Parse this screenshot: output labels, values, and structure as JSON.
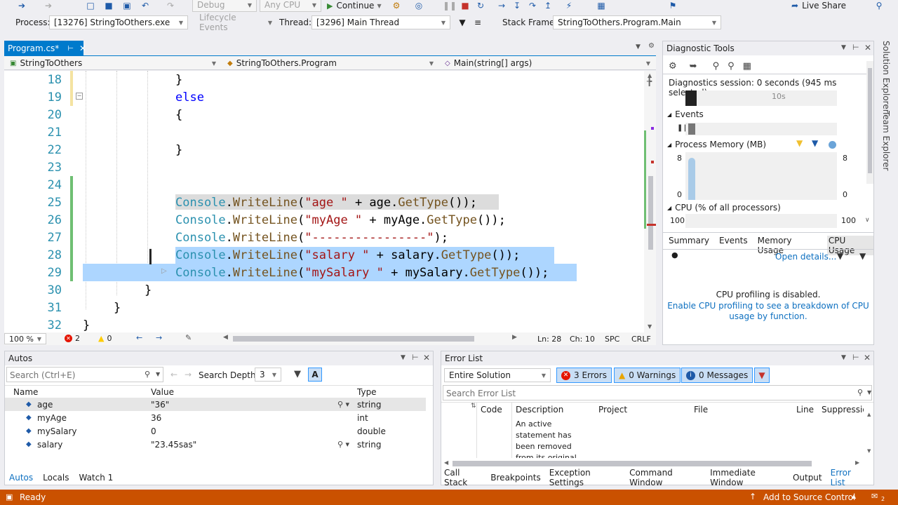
{
  "toolbar": {
    "config": "Debug",
    "platform": "Any CPU",
    "continue_label": "Continue",
    "live_share": "Live Share",
    "process_label": "Process:",
    "process_value": "[13276] StringToOthers.exe",
    "lifecycle_label": "Lifecycle Events",
    "thread_label": "Thread:",
    "thread_value": "[3296] Main Thread",
    "stackframe_label": "Stack Frame:",
    "stackframe_value": "StringToOthers.Program.Main"
  },
  "editor": {
    "tab_label": "Program.cs*",
    "nav_project": "StringToOthers",
    "nav_class": "StringToOthers.Program",
    "nav_member": "Main(string[] args)",
    "lines": [
      {
        "n": "18",
        "tokens": [
          {
            "t": "}",
            "c": ""
          }
        ]
      },
      {
        "n": "19",
        "tokens": [
          {
            "t": "else",
            "c": "kw"
          }
        ]
      },
      {
        "n": "20",
        "tokens": [
          {
            "t": "{",
            "c": ""
          }
        ]
      },
      {
        "n": "21",
        "tokens": []
      },
      {
        "n": "22",
        "tokens": [
          {
            "t": "}",
            "c": ""
          }
        ]
      },
      {
        "n": "23",
        "tokens": []
      },
      {
        "n": "24",
        "tokens": []
      },
      {
        "n": "25",
        "tokens": [
          {
            "t": "Console",
            "c": "cls"
          },
          {
            "t": ".",
            "c": ""
          },
          {
            "t": "WriteLine",
            "c": "mth"
          },
          {
            "t": "(",
            "c": ""
          },
          {
            "t": "\"age \"",
            "c": "str"
          },
          {
            "t": " + age.",
            "c": ""
          },
          {
            "t": "GetType",
            "c": "mth"
          },
          {
            "t": "());",
            "c": ""
          }
        ]
      },
      {
        "n": "26",
        "tokens": [
          {
            "t": "Console",
            "c": "cls"
          },
          {
            "t": ".",
            "c": ""
          },
          {
            "t": "WriteLine",
            "c": "mth"
          },
          {
            "t": "(",
            "c": ""
          },
          {
            "t": "\"myAge \"",
            "c": "str"
          },
          {
            "t": " + myAge.",
            "c": ""
          },
          {
            "t": "GetType",
            "c": "mth"
          },
          {
            "t": "());",
            "c": ""
          }
        ]
      },
      {
        "n": "27",
        "tokens": [
          {
            "t": "Console",
            "c": "cls"
          },
          {
            "t": ".",
            "c": ""
          },
          {
            "t": "WriteLine",
            "c": "mth"
          },
          {
            "t": "(",
            "c": ""
          },
          {
            "t": "\"----------------\"",
            "c": "str"
          },
          {
            "t": ");",
            "c": ""
          }
        ]
      },
      {
        "n": "28",
        "tokens": [
          {
            "t": "Console",
            "c": "cls"
          },
          {
            "t": ".",
            "c": ""
          },
          {
            "t": "WriteLine",
            "c": "mth"
          },
          {
            "t": "(",
            "c": ""
          },
          {
            "t": "\"salary \"",
            "c": "str"
          },
          {
            "t": " + salary.",
            "c": ""
          },
          {
            "t": "GetType",
            "c": "mth"
          },
          {
            "t": "());",
            "c": ""
          }
        ]
      },
      {
        "n": "29",
        "tokens": [
          {
            "t": "Console",
            "c": "cls"
          },
          {
            "t": ".",
            "c": ""
          },
          {
            "t": "WriteLine",
            "c": "mth"
          },
          {
            "t": "(",
            "c": ""
          },
          {
            "t": "\"mySalary \"",
            "c": "str"
          },
          {
            "t": " + mySalary.",
            "c": ""
          },
          {
            "t": "GetType",
            "c": "mth"
          },
          {
            "t": "());",
            "c": ""
          }
        ]
      },
      {
        "n": "30",
        "tokens": [
          {
            "t": "}",
            "c": ""
          }
        ]
      },
      {
        "n": "31",
        "tokens": [
          {
            "t": "}",
            "c": ""
          }
        ]
      },
      {
        "n": "32",
        "tokens": [
          {
            "t": "}",
            "c": ""
          }
        ]
      }
    ],
    "zoom": "100 %",
    "errors_count": "2",
    "warnings_count": "0",
    "ln": "Ln: 28",
    "ch": "Ch: 10",
    "spc": "SPC",
    "crlf": "CRLF"
  },
  "diagnostics": {
    "title": "Diagnostic Tools",
    "session": "Diagnostics session: 0 seconds (945 ms selected)",
    "tick_10s": "10s",
    "events": "Events",
    "process_memory": "Process Memory (MB)",
    "mem_max": "8",
    "mem_min": "0",
    "mem_max_r": "8",
    "mem_min_r": "0",
    "cpu": "CPU (% of all processors)",
    "cpu_max": "100",
    "cpu_max_r": "100",
    "tabs": [
      "Summary",
      "Events",
      "Memory Usage",
      "CPU Usage"
    ],
    "open_details": "Open details...",
    "profiling_disabled": "CPU profiling is disabled.",
    "enable_profiling": "Enable CPU profiling to see a breakdown of CPU usage by function."
  },
  "side_rail": [
    "Solution Explorer",
    "Team Explorer"
  ],
  "autos": {
    "title": "Autos",
    "search_placeholder": "Search (Ctrl+E)",
    "search_depth_label": "Search Depth:",
    "search_depth": "3",
    "headers": [
      "Name",
      "Value",
      "Type"
    ],
    "rows": [
      {
        "name": "age",
        "value": "\"36\"",
        "type": "string"
      },
      {
        "name": "myAge",
        "value": "36",
        "type": "int"
      },
      {
        "name": "mySalary",
        "value": "0",
        "type": "double"
      },
      {
        "name": "salary",
        "value": "\"23.45sas\"",
        "type": "string"
      }
    ],
    "tabs": [
      "Autos",
      "Locals",
      "Watch 1"
    ]
  },
  "errors": {
    "title": "Error List",
    "scope": "Entire Solution",
    "errors_btn": "3 Errors",
    "warnings_btn": "0 Warnings",
    "messages_btn": "0 Messages",
    "search_placeholder": "Search Error List",
    "headers": [
      "Code",
      "Description",
      "Project",
      "File",
      "Line",
      "Suppression"
    ],
    "desc_lines": [
      "An active",
      "statement has",
      "been removed",
      "from its original"
    ],
    "tabs": [
      "Call Stack",
      "Breakpoints",
      "Exception Settings",
      "Command Window",
      "Immediate Window",
      "Output",
      "Error List"
    ]
  },
  "status": {
    "ready": "Ready",
    "source_control": "Add to Source Control",
    "badge": "2"
  }
}
